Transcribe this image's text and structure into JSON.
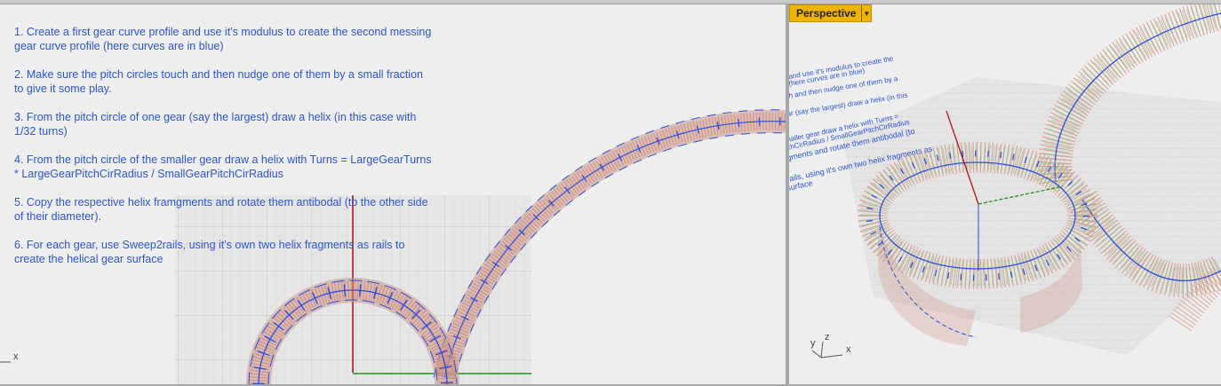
{
  "top_view": {
    "notes": [
      "1. Create a first gear curve profile and use it's modulus to create the second messing gear curve profile (here curves are in blue)",
      "2. Make sure the pitch circles touch and then nudge one of them by a small fraction to give it some play.",
      "3. From the pitch circle of one gear (say the largest) draw a helix (in this case with 1/32 turns)",
      "4. From the pitch circle of the smaller gear draw a helix with Turns = LargeGearTurns * LargeGearPitchCirRadius / SmallGearPitchCirRadius",
      "5. Copy the respective helix framgments and rotate them antibodal (to the other side of their diameter).",
      "6. For each gear, use Sweep2rails, using it's own two helix fragments as rails to create the helical gear surface"
    ],
    "axis_x": "x"
  },
  "perspective_view": {
    "tab_label": "Perspective",
    "menu_icon": "dropdown-arrow-icon",
    "axis_x": "x",
    "axis_y": "y",
    "axis_z": "z"
  },
  "colors": {
    "curve_blue": "#2b4fe0",
    "gear_red": "#d0867a",
    "gear_green": "#8fc48f",
    "axis_red": "#b01414",
    "axis_green": "#1f8f1f",
    "tab_yellow": "#f2b200"
  }
}
